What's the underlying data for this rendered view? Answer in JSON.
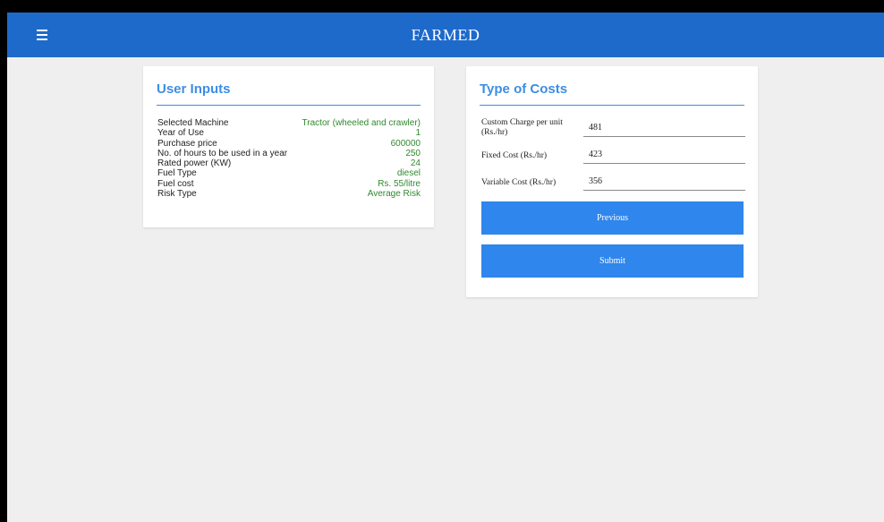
{
  "header": {
    "title": "FARMED",
    "menu_icon": "hamburger-menu-icon"
  },
  "user_inputs": {
    "title": "User Inputs",
    "rows": [
      {
        "label": "Selected Machine",
        "value": "Tractor (wheeled and crawler)"
      },
      {
        "label": "Year of Use",
        "value": "1"
      },
      {
        "label": "Purchase price",
        "value": "600000"
      },
      {
        "label": "No. of hours to be used in a year",
        "value": "250"
      },
      {
        "label": "Rated power (KW)",
        "value": "24"
      },
      {
        "label": "Fuel Type",
        "value": "diesel"
      },
      {
        "label": "Fuel cost",
        "value": "Rs. 55/litre"
      },
      {
        "label": "Risk Type",
        "value": "Average Risk"
      }
    ]
  },
  "type_of_costs": {
    "title": "Type of Costs",
    "fields": [
      {
        "label": "Custom Charge per unit (Rs./hr)",
        "value": "481"
      },
      {
        "label": "Fixed Cost (Rs./hr)",
        "value": "423"
      },
      {
        "label": "Variable Cost (Rs./hr)",
        "value": "356"
      }
    ],
    "previous_label": "Previous",
    "submit_label": "Submit"
  },
  "colors": {
    "header_bg": "#1e6acb",
    "accent": "#3d8de6",
    "button_bg": "#2f86ec",
    "value_green": "#2f8a2f",
    "page_bg": "#efefef"
  }
}
